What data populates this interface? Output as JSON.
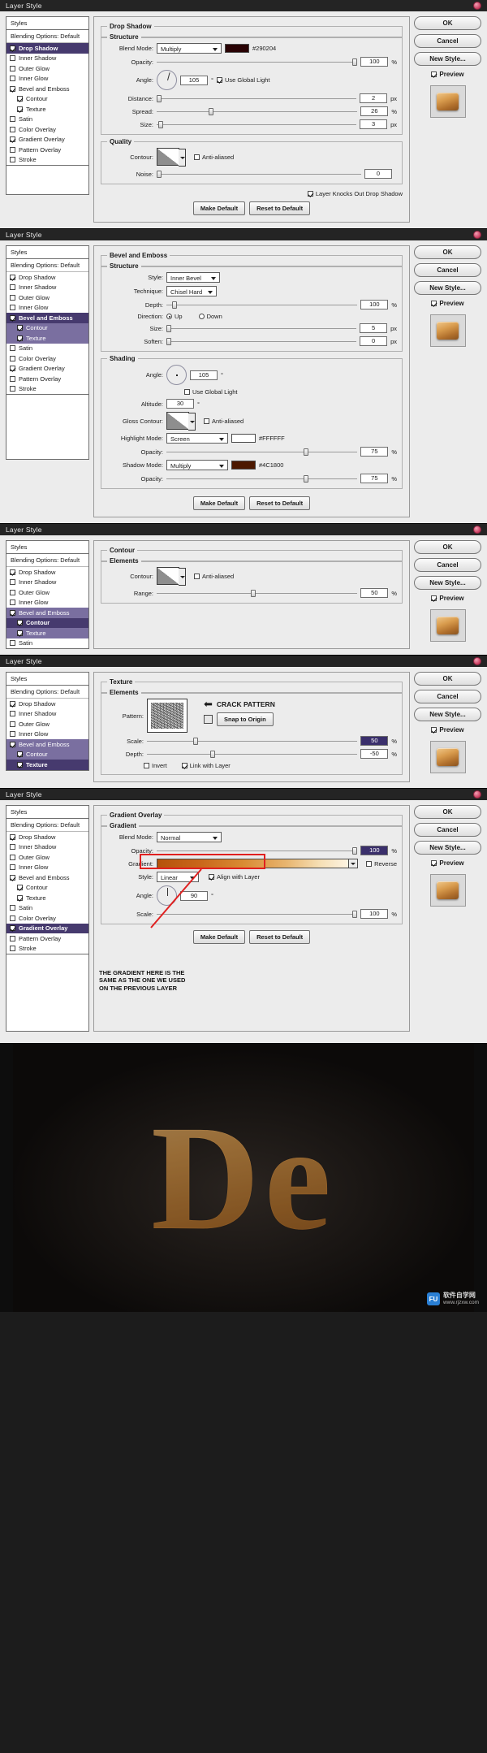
{
  "window_title": "Layer Style",
  "styles_panel": {
    "header": "Styles",
    "blending_options": "Blending Options: Default",
    "items": [
      {
        "label": "Drop Shadow",
        "checked": true
      },
      {
        "label": "Inner Shadow",
        "checked": false
      },
      {
        "label": "Outer Glow",
        "checked": false
      },
      {
        "label": "Inner Glow",
        "checked": false
      },
      {
        "label": "Bevel and Emboss",
        "checked": true
      },
      {
        "label": "Contour",
        "checked": true,
        "indent": true
      },
      {
        "label": "Texture",
        "checked": true,
        "indent": true
      },
      {
        "label": "Satin",
        "checked": false
      },
      {
        "label": "Color Overlay",
        "checked": false
      },
      {
        "label": "Gradient Overlay",
        "checked": true
      },
      {
        "label": "Pattern Overlay",
        "checked": false
      },
      {
        "label": "Stroke",
        "checked": false
      }
    ]
  },
  "buttons": {
    "ok": "OK",
    "cancel": "Cancel",
    "new_style": "New Style...",
    "preview": "Preview",
    "make_default": "Make Default",
    "reset_to_default": "Reset to Default"
  },
  "labels": {
    "blend_mode": "Blend Mode:",
    "opacity": "Opacity:",
    "angle": "Angle:",
    "distance": "Distance:",
    "spread": "Spread:",
    "size": "Size:",
    "contour": "Contour:",
    "noise": "Noise:",
    "style": "Style:",
    "technique": "Technique:",
    "depth": "Depth:",
    "direction": "Direction:",
    "soften": "Soften:",
    "altitude": "Altitude:",
    "gloss_contour": "Gloss Contour:",
    "highlight_mode": "Highlight Mode:",
    "shadow_mode": "Shadow Mode:",
    "range": "Range:",
    "pattern": "Pattern:",
    "scale": "Scale:",
    "gradient": "Gradient:",
    "use_global_light": "Use Global Light",
    "anti_aliased": "Anti-aliased",
    "layer_knocks_out": "Layer Knocks Out Drop Shadow",
    "up": "Up",
    "down": "Down",
    "invert": "Invert",
    "link_with_layer": "Link with Layer",
    "snap_to_origin": "Snap to Origin",
    "reverse": "Reverse",
    "align_with_layer": "Align with Layer",
    "percent": "%",
    "px": "px",
    "deg": "°"
  },
  "dialog1": {
    "section": "Drop Shadow",
    "sub_section": "Structure",
    "quality_section": "Quality",
    "blend_mode": "Multiply",
    "color_hex": "#290204",
    "color_label": "#290204",
    "opacity": "100",
    "angle": "105",
    "use_global_light": true,
    "distance": "2",
    "spread": "26",
    "size": "3",
    "anti_aliased": false,
    "noise": "0",
    "layer_knocks_out": true
  },
  "dialog2": {
    "section": "Bevel and Emboss",
    "sub_section": "Structure",
    "shading_section": "Shading",
    "style": "Inner Bevel",
    "technique": "Chisel Hard",
    "depth": "100",
    "direction": "Up",
    "size": "5",
    "soften": "0",
    "angle": "105",
    "use_global_light": false,
    "altitude": "30",
    "anti_aliased": false,
    "highlight_mode": "Screen",
    "highlight_color_hex": "#FFFFFF",
    "highlight_color_label": "#FFFFFF",
    "highlight_opacity": "75",
    "shadow_mode": "Multiply",
    "shadow_color_hex": "#4C1800",
    "shadow_color_label": "#4C1800",
    "shadow_opacity": "75"
  },
  "dialog3": {
    "section": "Contour",
    "sub_section": "Elements",
    "anti_aliased": false,
    "range": "50"
  },
  "dialog4": {
    "section": "Texture",
    "sub_section": "Elements",
    "pattern_note": "CRACK PATTERN",
    "scale": "50",
    "depth": "-50",
    "invert": false,
    "link_with_layer": true
  },
  "dialog5": {
    "section": "Gradient Overlay",
    "sub_section": "Gradient",
    "blend_mode": "Normal",
    "opacity": "100",
    "reverse": false,
    "style": "Linear",
    "align_with_layer": true,
    "angle": "90",
    "scale": "100",
    "annotation": "THE GRADIENT HERE IS THE\nSAME AS THE ONE WE USED\nON THE PREVIOUS LAYER"
  },
  "hero": {
    "text": "De",
    "watermark_badge": "FU",
    "watermark_title": "软件自学网",
    "watermark_url": "www.rjzxw.com"
  },
  "colors": {
    "selected_row": "#463a6e",
    "selected_sub_row": "#7a6fa0",
    "accent_red": "#e02020",
    "titlebar": "#242424"
  }
}
